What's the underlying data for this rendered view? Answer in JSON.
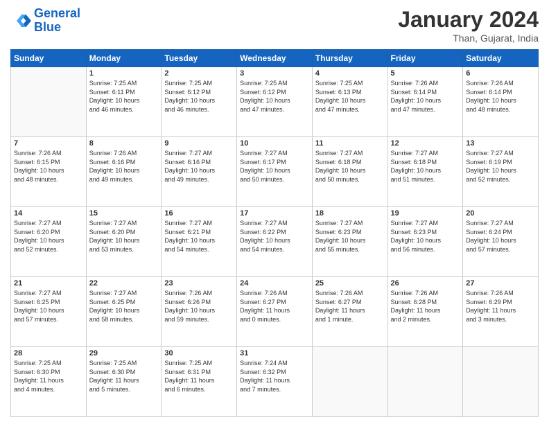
{
  "logo": {
    "line1": "General",
    "line2": "Blue"
  },
  "title": "January 2024",
  "subtitle": "Than, Gujarat, India",
  "days_of_week": [
    "Sunday",
    "Monday",
    "Tuesday",
    "Wednesday",
    "Thursday",
    "Friday",
    "Saturday"
  ],
  "weeks": [
    [
      {
        "day": "",
        "info": ""
      },
      {
        "day": "1",
        "info": "Sunrise: 7:25 AM\nSunset: 6:11 PM\nDaylight: 10 hours\nand 46 minutes."
      },
      {
        "day": "2",
        "info": "Sunrise: 7:25 AM\nSunset: 6:12 PM\nDaylight: 10 hours\nand 46 minutes."
      },
      {
        "day": "3",
        "info": "Sunrise: 7:25 AM\nSunset: 6:12 PM\nDaylight: 10 hours\nand 47 minutes."
      },
      {
        "day": "4",
        "info": "Sunrise: 7:25 AM\nSunset: 6:13 PM\nDaylight: 10 hours\nand 47 minutes."
      },
      {
        "day": "5",
        "info": "Sunrise: 7:26 AM\nSunset: 6:14 PM\nDaylight: 10 hours\nand 47 minutes."
      },
      {
        "day": "6",
        "info": "Sunrise: 7:26 AM\nSunset: 6:14 PM\nDaylight: 10 hours\nand 48 minutes."
      }
    ],
    [
      {
        "day": "7",
        "info": "Sunrise: 7:26 AM\nSunset: 6:15 PM\nDaylight: 10 hours\nand 48 minutes."
      },
      {
        "day": "8",
        "info": "Sunrise: 7:26 AM\nSunset: 6:16 PM\nDaylight: 10 hours\nand 49 minutes."
      },
      {
        "day": "9",
        "info": "Sunrise: 7:27 AM\nSunset: 6:16 PM\nDaylight: 10 hours\nand 49 minutes."
      },
      {
        "day": "10",
        "info": "Sunrise: 7:27 AM\nSunset: 6:17 PM\nDaylight: 10 hours\nand 50 minutes."
      },
      {
        "day": "11",
        "info": "Sunrise: 7:27 AM\nSunset: 6:18 PM\nDaylight: 10 hours\nand 50 minutes."
      },
      {
        "day": "12",
        "info": "Sunrise: 7:27 AM\nSunset: 6:18 PM\nDaylight: 10 hours\nand 51 minutes."
      },
      {
        "day": "13",
        "info": "Sunrise: 7:27 AM\nSunset: 6:19 PM\nDaylight: 10 hours\nand 52 minutes."
      }
    ],
    [
      {
        "day": "14",
        "info": "Sunrise: 7:27 AM\nSunset: 6:20 PM\nDaylight: 10 hours\nand 52 minutes."
      },
      {
        "day": "15",
        "info": "Sunrise: 7:27 AM\nSunset: 6:20 PM\nDaylight: 10 hours\nand 53 minutes."
      },
      {
        "day": "16",
        "info": "Sunrise: 7:27 AM\nSunset: 6:21 PM\nDaylight: 10 hours\nand 54 minutes."
      },
      {
        "day": "17",
        "info": "Sunrise: 7:27 AM\nSunset: 6:22 PM\nDaylight: 10 hours\nand 54 minutes."
      },
      {
        "day": "18",
        "info": "Sunrise: 7:27 AM\nSunset: 6:23 PM\nDaylight: 10 hours\nand 55 minutes."
      },
      {
        "day": "19",
        "info": "Sunrise: 7:27 AM\nSunset: 6:23 PM\nDaylight: 10 hours\nand 56 minutes."
      },
      {
        "day": "20",
        "info": "Sunrise: 7:27 AM\nSunset: 6:24 PM\nDaylight: 10 hours\nand 57 minutes."
      }
    ],
    [
      {
        "day": "21",
        "info": "Sunrise: 7:27 AM\nSunset: 6:25 PM\nDaylight: 10 hours\nand 57 minutes."
      },
      {
        "day": "22",
        "info": "Sunrise: 7:27 AM\nSunset: 6:25 PM\nDaylight: 10 hours\nand 58 minutes."
      },
      {
        "day": "23",
        "info": "Sunrise: 7:26 AM\nSunset: 6:26 PM\nDaylight: 10 hours\nand 59 minutes."
      },
      {
        "day": "24",
        "info": "Sunrise: 7:26 AM\nSunset: 6:27 PM\nDaylight: 11 hours\nand 0 minutes."
      },
      {
        "day": "25",
        "info": "Sunrise: 7:26 AM\nSunset: 6:27 PM\nDaylight: 11 hours\nand 1 minute."
      },
      {
        "day": "26",
        "info": "Sunrise: 7:26 AM\nSunset: 6:28 PM\nDaylight: 11 hours\nand 2 minutes."
      },
      {
        "day": "27",
        "info": "Sunrise: 7:26 AM\nSunset: 6:29 PM\nDaylight: 11 hours\nand 3 minutes."
      }
    ],
    [
      {
        "day": "28",
        "info": "Sunrise: 7:25 AM\nSunset: 6:30 PM\nDaylight: 11 hours\nand 4 minutes."
      },
      {
        "day": "29",
        "info": "Sunrise: 7:25 AM\nSunset: 6:30 PM\nDaylight: 11 hours\nand 5 minutes."
      },
      {
        "day": "30",
        "info": "Sunrise: 7:25 AM\nSunset: 6:31 PM\nDaylight: 11 hours\nand 6 minutes."
      },
      {
        "day": "31",
        "info": "Sunrise: 7:24 AM\nSunset: 6:32 PM\nDaylight: 11 hours\nand 7 minutes."
      },
      {
        "day": "",
        "info": ""
      },
      {
        "day": "",
        "info": ""
      },
      {
        "day": "",
        "info": ""
      }
    ]
  ]
}
